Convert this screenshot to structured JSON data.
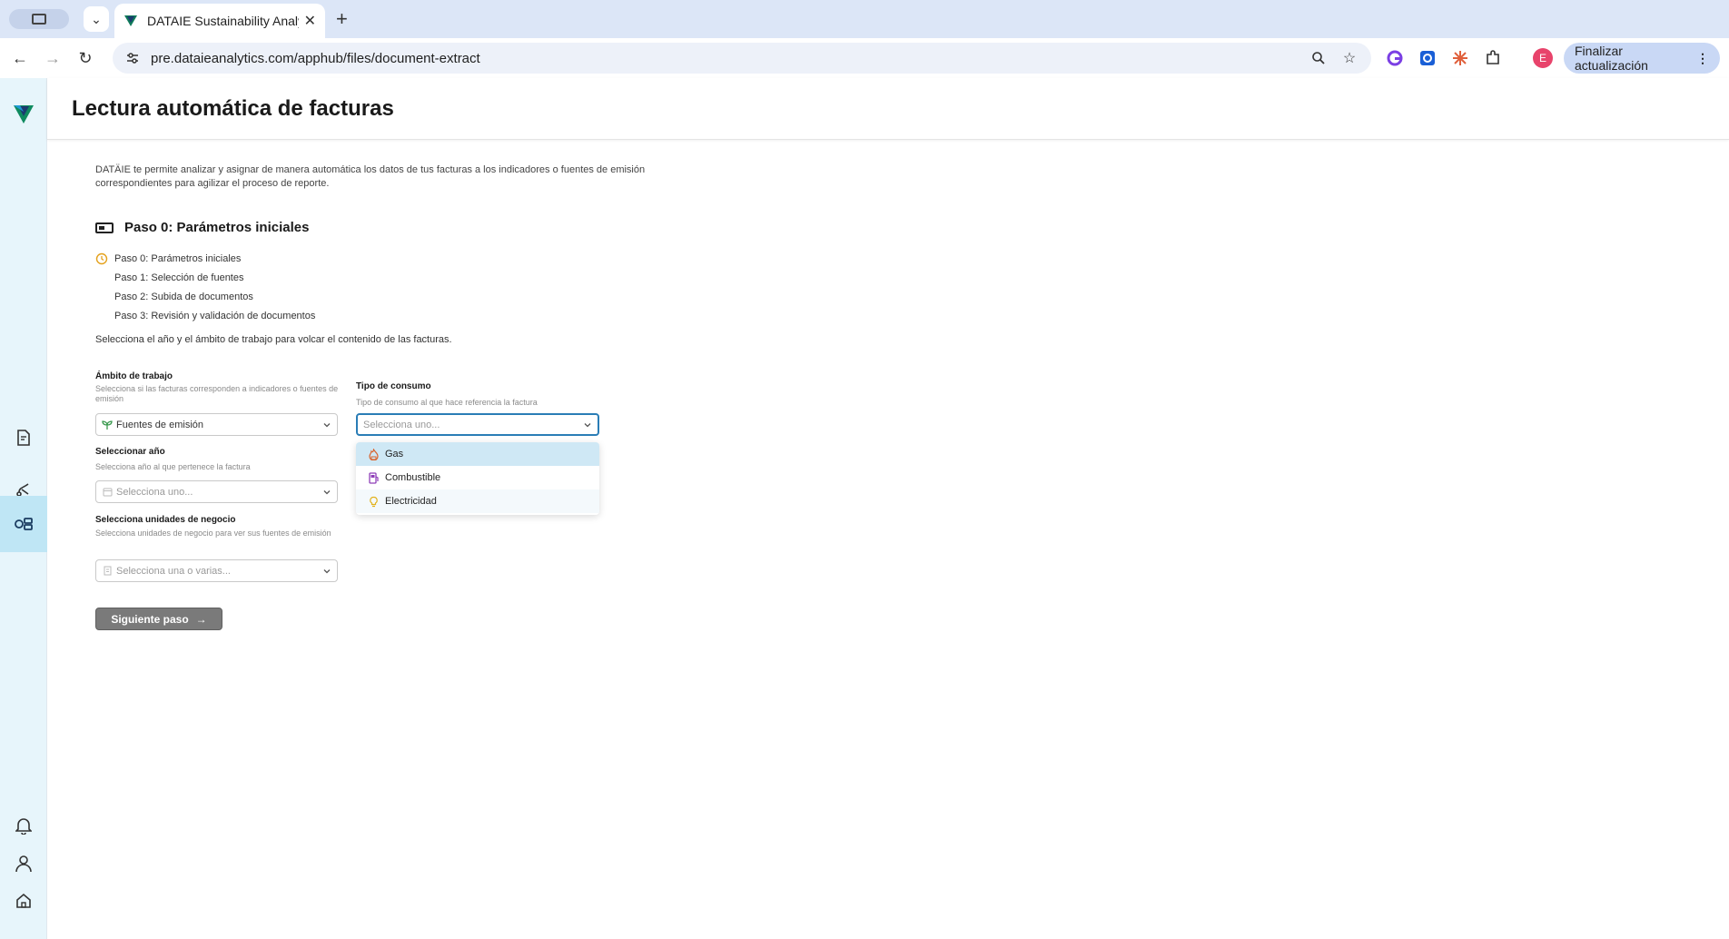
{
  "browser": {
    "tab_title": "DATAIE Sustainability Analytic",
    "url": "pre.dataieanalytics.com/apphub/files/document-extract",
    "profile_initial": "E",
    "update_button": "Finalizar actualización"
  },
  "page": {
    "title": "Lectura automática de facturas",
    "intro": "DATÄIE te permite analizar y asignar de manera automática los datos de tus facturas a los indicadores o fuentes de emisión correspondientes para agilizar el proceso de reporte.",
    "step_heading": "Paso 0: Parámetros iniciales",
    "steps": [
      "Paso 0: Parámetros iniciales",
      "Paso 1: Selección de fuentes",
      "Paso 2: Subida de documentos",
      "Paso 3: Revisión y validación de documentos"
    ],
    "instruction": "Selecciona el año y el ámbito de trabajo para volcar el contenido de las facturas."
  },
  "form": {
    "ambito": {
      "label": "Ámbito de trabajo",
      "help": "Selecciona si las facturas corresponden a indicadores o fuentes de emisión",
      "value": "Fuentes de emisión"
    },
    "tipo": {
      "label": "Tipo de consumo",
      "help": "Tipo de consumo al que hace referencia la factura",
      "placeholder": "Selecciona uno...",
      "options": [
        "Gas",
        "Combustible",
        "Electricidad"
      ]
    },
    "anio": {
      "label": "Seleccionar año",
      "help": "Selecciona año al que pertenece la factura",
      "placeholder": "Selecciona uno..."
    },
    "unidades": {
      "label": "Selecciona unidades de negocio",
      "help": "Selecciona unidades de negocio para ver sus fuentes de emisión",
      "placeholder": "Selecciona una o varias..."
    },
    "next_button": "Siguiente paso"
  }
}
